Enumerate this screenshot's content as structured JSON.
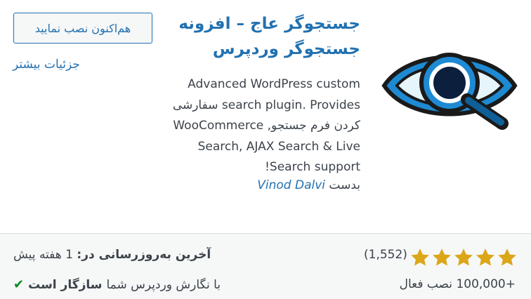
{
  "plugin": {
    "title_line1": "جستجوگر عاج – افزونه",
    "title_line2": "جستجوگر وردپرس",
    "description_lines": [
      "Advanced WordPress custom",
      "search plugin. Provides سفارشی",
      "کردن فرم جستجو, WooCommerce",
      "Search, AJAX Search & Live",
      "Search support!"
    ],
    "author_prefix": "بدست",
    "author_name": "Vinod Dalvi",
    "icon": "eye-magnifier-icon"
  },
  "actions": {
    "install_label": "هم‌اکنون نصب نمایید",
    "details_label": "جزئیات بیشتر"
  },
  "footer": {
    "rating_stars": 5,
    "rating_count": "(1,552)",
    "installs": "+100,000 نصب فعال",
    "last_updated_label": "آخرین به‌روزرسانی در:",
    "last_updated_value": "1 هفته پیش",
    "compat_prefix": "با نگارش وردپرس شما",
    "compat_value": "سازگار است"
  },
  "colors": {
    "link": "#2271b1",
    "star": "#dba617",
    "check": "#008a20",
    "footer_bg": "#f6f7f7"
  }
}
